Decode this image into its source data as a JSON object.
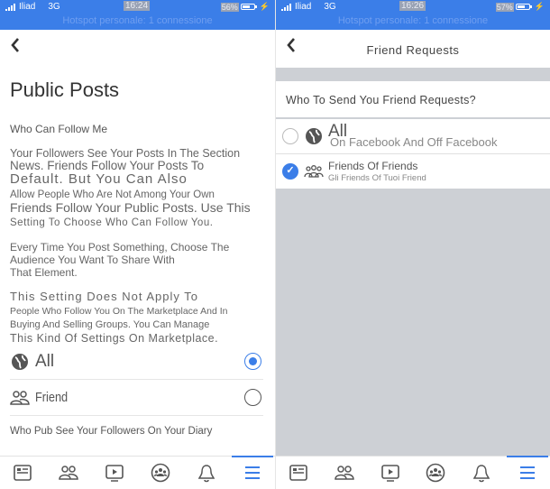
{
  "left": {
    "status": {
      "carrier": "Iliad",
      "network": "3G",
      "time": "16:24",
      "battery": "56%",
      "hotspot": "Hotspot personale: 1 connessione"
    },
    "nav": {
      "back_icon": "chevron-left-icon"
    },
    "title": "Public Posts",
    "section_label": "Who Can Follow Me",
    "paragraphs": [
      "Your Followers See Your Posts In The Section",
      "News. Friends Follow Your Posts To",
      "Default. But You Can Also",
      "Allow People Who Are Not Among Your Own",
      "Friends Follow Your Public Posts. Use This",
      "Setting To Choose Who Can Follow You.",
      "Every Time You Post Something, Choose The",
      "Audience You Want To Share With",
      "That Element.",
      "This Setting Does Not Apply To",
      "People Who Follow You On The Marketplace And In",
      "Buying And Selling Groups. You Can Manage",
      "This Kind Of Settings On Marketplace."
    ],
    "options": [
      {
        "label": "All",
        "icon": "globe-icon",
        "selected": true
      },
      {
        "label": "Friend",
        "icon": "friends-icon",
        "selected": false
      }
    ],
    "diary_question": "Who Pub See Your Followers On Your Diary"
  },
  "right": {
    "status": {
      "carrier": "Iliad",
      "network": "3G",
      "time": "16:26",
      "battery": "57%",
      "hotspot": "Hotspot personale: 1 connessione"
    },
    "nav": {
      "title": "Friend Requests",
      "back_icon": "chevron-left-icon"
    },
    "question": "Who To Send You Friend Requests?",
    "options": [
      {
        "title": "All",
        "subtitle": "On Facebook And Off Facebook",
        "icon": "globe-icon",
        "selected": false
      },
      {
        "title": "Friends Of Friends",
        "subtitle": "Gli Friends Of Tuoi Friend",
        "icon": "friends-group-icon",
        "selected": true
      }
    ]
  },
  "tabbar": {
    "tabs": [
      {
        "name": "news-feed",
        "icon": "news-feed-icon",
        "active": false
      },
      {
        "name": "friends",
        "icon": "friends-icon",
        "active": false
      },
      {
        "name": "watch",
        "icon": "video-icon",
        "active": false
      },
      {
        "name": "groups",
        "icon": "groups-icon",
        "active": false
      },
      {
        "name": "notifications",
        "icon": "bell-icon",
        "active": false
      },
      {
        "name": "menu",
        "icon": "hamburger-menu-icon",
        "active": true
      }
    ]
  },
  "colors": {
    "accent": "#3b7ee8",
    "statusbar": "#3b7ee8",
    "gray_bg": "#cdd0d5"
  }
}
